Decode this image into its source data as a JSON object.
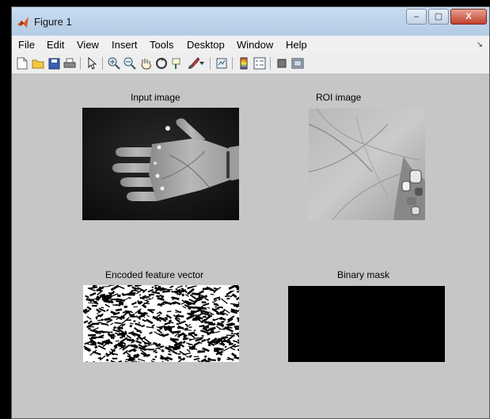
{
  "window": {
    "title": "Figure 1",
    "minimize": "–",
    "maximize": "▢",
    "close": "X"
  },
  "menu": {
    "items": [
      "File",
      "Edit",
      "View",
      "Insert",
      "Tools",
      "Desktop",
      "Window",
      "Help"
    ],
    "overflow": "↘"
  },
  "toolbar": {
    "icons": [
      "new-figure-icon",
      "open-file-icon",
      "save-icon",
      "print-icon",
      "select-arrow-icon",
      "zoom-in-icon",
      "zoom-out-icon",
      "pan-hand-icon",
      "rotate-3d-icon",
      "data-cursor-icon",
      "brush-icon",
      "brush-dropdown-icon",
      "link-plot-icon",
      "colorbar-icon",
      "legend-icon",
      "hide-plot-tools-icon",
      "show-plot-tools-icon"
    ]
  },
  "axes": [
    {
      "title": "Input image"
    },
    {
      "title": "ROI image"
    },
    {
      "title": "Encoded feature vector"
    },
    {
      "title": "Binary mask"
    }
  ],
  "colors": {
    "window_bg": "#c6c6c6",
    "titlebar": "#c8dcf0",
    "close_button": "#c0422e"
  }
}
